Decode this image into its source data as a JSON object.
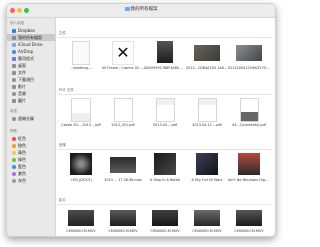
{
  "window": {
    "title": "我的所有檔案"
  },
  "sidebar": {
    "sections": [
      {
        "label": "個人收藏"
      },
      {
        "label": "裝置"
      },
      {
        "label": "標籤"
      }
    ],
    "favorites": [
      {
        "label": "Dropbox",
        "icon": "dropbox-icon",
        "color": "#2f7fd6"
      },
      {
        "label": "我的所有檔案",
        "icon": "all-files-icon",
        "color": "#8a8a8a"
      },
      {
        "label": "iCloud Drive",
        "icon": "cloud-icon",
        "color": "#7aa8e0"
      },
      {
        "label": "AirDrop",
        "icon": "airdrop-icon",
        "color": "#3b8ee8"
      },
      {
        "label": "應用程式",
        "icon": "applications-icon",
        "color": "#6d7bd9"
      },
      {
        "label": "桌面",
        "icon": "desktop-icon",
        "color": "#8f8f8f"
      },
      {
        "label": "文件",
        "icon": "documents-icon",
        "color": "#8f8f8f"
      },
      {
        "label": "下載項目",
        "icon": "downloads-icon",
        "color": "#8f8f8f"
      },
      {
        "label": "影片",
        "icon": "movies-icon",
        "color": "#8f8f8f"
      },
      {
        "label": "音樂",
        "icon": "music-icon",
        "color": "#8f8f8f"
      },
      {
        "label": "圖片",
        "icon": "pictures-icon",
        "color": "#8f8f8f"
      }
    ],
    "devices": [
      {
        "label": "遠端光碟",
        "icon": "remote-disc-icon",
        "color": "#8f8f8f"
      }
    ],
    "tags": [
      {
        "label": "紅色",
        "color": "#f24a42"
      },
      {
        "label": "橙色",
        "color": "#f49a2b"
      },
      {
        "label": "黃色",
        "color": "#f2cf2c"
      },
      {
        "label": "綠色",
        "color": "#5fc64f"
      },
      {
        "label": "藍色",
        "color": "#3c8ae8"
      },
      {
        "label": "紫色",
        "color": "#b36ad9"
      },
      {
        "label": "灰色",
        "color": "#9b9b9b"
      }
    ],
    "selected": "我的所有檔案"
  },
  "main": {
    "sections": [
      {
        "label": "文件",
        "items": [
          {
            "name": "...sheeting....",
            "thumb": "doc"
          },
          {
            "name": "00 Frame - Cosmic Of...ine Edition).jpg",
            "thumb": "x"
          },
          {
            "name": "DA009991788F4A80 D9E209...69B9A7.jpg",
            "thumb": "dark"
          },
          {
            "name": "2013...1DB4A7A3 1A8B7689...043E.jpg",
            "thumb": "photo1"
          },
          {
            "name": "0211200412549CD F5A91...0C3A35.jpg",
            "thumb": "photo2"
          }
        ]
      },
      {
        "label": "PDF 文件",
        "items": [
          {
            "name": "Cassie SO... 2013 ...pdf",
            "thumb": "pdf1"
          },
          {
            "name": "2013_001.pdf",
            "thumb": "pdf2"
          },
          {
            "name": "2013-05 ...pdf",
            "thumb": "pdf3"
          },
          {
            "name": "2013-04-11 ...pdf",
            "thumb": "pdf4"
          },
          {
            "name": "04…1(contents).pdf",
            "thumb": "pdf5"
          }
        ]
      },
      {
        "label": "音樂",
        "items": [
          {
            "name": "+ED [DOCS]",
            "thumb": "music1"
          },
          {
            "name": "2013 ... 17.36.56.mov",
            "thumb": "video1"
          },
          {
            "name": "A Stop In A Bottle",
            "thumb": "video2"
          },
          {
            "name": "A Sky Full Of Stars",
            "thumb": "music2"
          },
          {
            "name": "Ain't No Mountain High Enough",
            "thumb": "music3"
          }
        ]
      },
      {
        "label": "影片",
        "items": [
          {
            "name": "CM40000-M.MOV",
            "thumb": "vid1"
          },
          {
            "name": "CM40000-M.MOV",
            "thumb": "vid2"
          },
          {
            "name": "CM40000-M.MOV",
            "thumb": "vid3"
          },
          {
            "name": "CM40000-M.MOV",
            "thumb": "vid4"
          },
          {
            "name": "CM40000-M.MOV",
            "thumb": "vid5"
          }
        ]
      }
    ]
  },
  "colors": {
    "window_bg": "#ffffff",
    "sidebar_bg": "#e9e9ea",
    "selection_bg": "#c9c9cb",
    "titlebar_bg": "#ececec",
    "close": "#fc605c",
    "minimize": "#fdbc40",
    "zoom": "#34c84a"
  }
}
